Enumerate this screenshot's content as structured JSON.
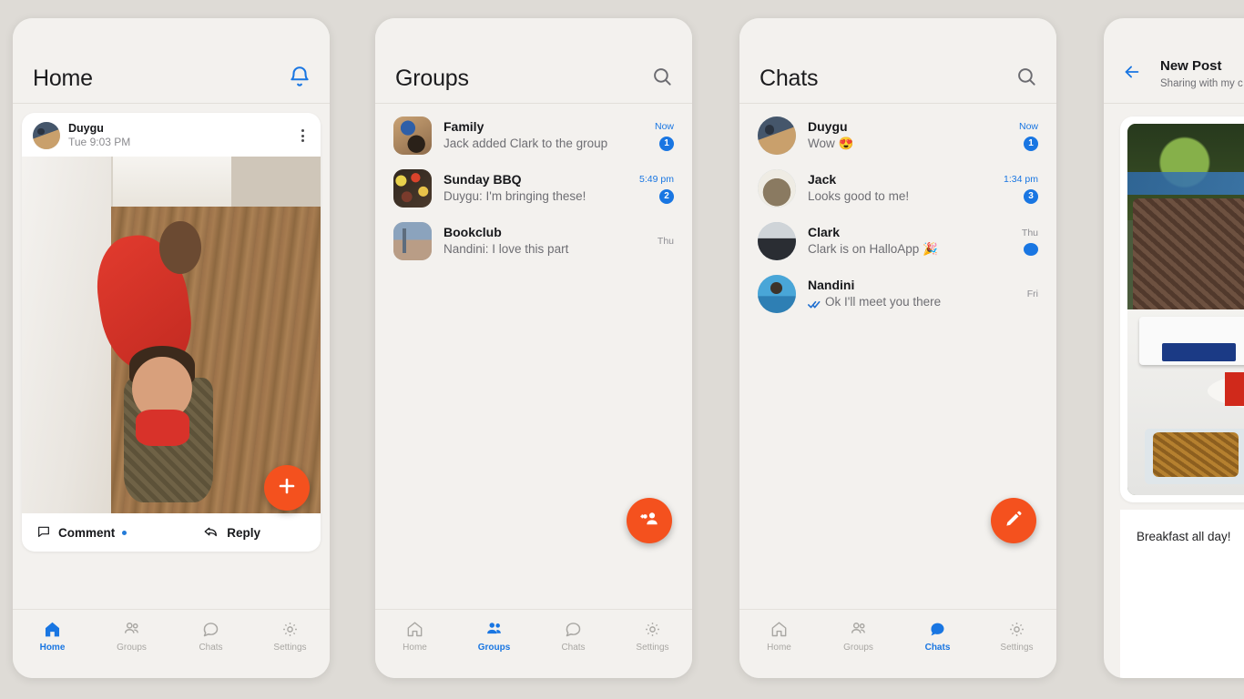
{
  "theme": {
    "background": "#dedbd6",
    "panel": "#f3f1ee",
    "accent_blue": "#1976e2",
    "accent_orange": "#f4511e",
    "text_primary": "#17181b",
    "text_secondary": "#6e6e73"
  },
  "screens": {
    "home": {
      "title": "Home",
      "header_icon": "bell-icon",
      "post": {
        "author": "Duygu",
        "timestamp": "Tue 9:03 PM",
        "menu_icon": "kebab-menu-icon",
        "photo_alt": "two-children-in-red-pajamas-hallway",
        "comment_label": "Comment",
        "comment_icon": "comment-icon",
        "comment_has_unread": true,
        "reply_label": "Reply",
        "reply_icon": "reply-icon"
      },
      "fab_icon": "plus-icon",
      "active_tab": "Home"
    },
    "groups": {
      "title": "Groups",
      "header_icon": "search-icon",
      "items": [
        {
          "thumb": "family-group-photo",
          "name": "Family",
          "preview": "Jack added Clark to the group",
          "time": "Now",
          "time_state": "unread",
          "badge": "1"
        },
        {
          "thumb": "bbq-grill-photo",
          "name": "Sunday BBQ",
          "preview": "Duygu: I'm bringing these!",
          "time": "5:49 pm",
          "time_state": "unread",
          "badge": "2"
        },
        {
          "thumb": "bookclub-photo",
          "name": "Bookclub",
          "preview": "Nandini: I love this part",
          "time": "Thu",
          "time_state": "read",
          "badge": ""
        }
      ],
      "fab_icon": "add-group-icon",
      "active_tab": "Groups"
    },
    "chats": {
      "title": "Chats",
      "header_icon": "search-icon",
      "items": [
        {
          "avatar": "duygu-avatar",
          "name": "Duygu",
          "preview": "Wow 😍",
          "time": "Now",
          "time_state": "unread",
          "badge": "1",
          "receipt": false
        },
        {
          "avatar": "jack-avatar",
          "name": "Jack",
          "preview": "Looks good to me!",
          "time": "1:34 pm",
          "time_state": "unread",
          "badge": "3",
          "receipt": false
        },
        {
          "avatar": "clark-avatar",
          "name": "Clark",
          "preview": "Clark is on HalloApp 🎉",
          "time": "Thu",
          "time_state": "read",
          "badge": "dot",
          "receipt": false
        },
        {
          "avatar": "nandini-avatar",
          "name": "Nandini",
          "preview": "Ok I'll meet you there",
          "time": "Fri",
          "time_state": "read",
          "badge": "",
          "receipt": true
        }
      ],
      "fab_icon": "compose-pencil-icon",
      "active_tab": "Chats"
    },
    "new_post": {
      "back_icon": "back-arrow-icon",
      "title": "New Post",
      "subtitle": "Sharing with my c",
      "photo_alt": "breakfast-spread-by-the-pool",
      "caption": "Breakfast all day!"
    }
  },
  "tabs": [
    {
      "label": "Home",
      "icon": "home-icon"
    },
    {
      "label": "Groups",
      "icon": "groups-icon"
    },
    {
      "label": "Chats",
      "icon": "chats-icon"
    },
    {
      "label": "Settings",
      "icon": "gear-icon"
    }
  ]
}
